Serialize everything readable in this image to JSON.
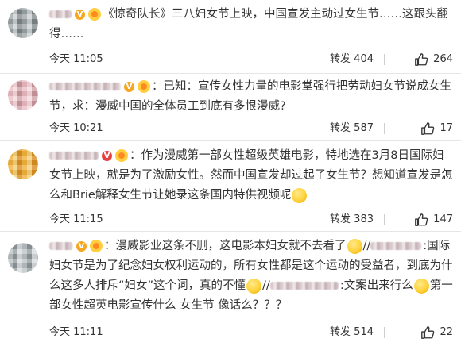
{
  "comments": [
    {
      "text": "《惊奇队长》三八妇女节上映，中国宣发主动过女生节……这跟头翻得……",
      "time": "今天 11:05",
      "repost_label": "转发",
      "repost_count": "404",
      "like_count": "264"
    },
    {
      "text": "：已知：宣传女性力量的电影堂强行把劳动妇女节说成女生节，求：漫威中国的全体员工到底有多恨漫威?",
      "time": "今天 10:21",
      "repost_label": "转发",
      "repost_count": "587",
      "like_count": "17"
    },
    {
      "text": "：作为漫威第一部女性超级英雄电影，特地选在3月8日国际妇女节上映，就是为了激励女性。然而中国宣发却过起了女生节？想知道宣发是怎么和Brie解释女生节让她录这条国内特供视频呢",
      "time": "今天 11:15",
      "repost_label": "转发",
      "repost_count": "383",
      "like_count": "147"
    },
    {
      "text_a": "：漫威影业这条不删，这电影本妇女就不去看了",
      "text_b": "//",
      "text_c": ":国际妇女节是为了纪念妇女权利运动的，所有女性都是这个运动的受益者，到底为什么这多人排斥“妇女”这个词，真的不懂",
      "text_d": "//",
      "text_e": ":文案出来行么",
      "text_f": "第一部女性超英电影宣传什么 女生节 像话么？？？",
      "time": "今天 11:11",
      "repost_label": "转发",
      "repost_count": "514",
      "like_count": "22"
    }
  ],
  "icons": {
    "like": "thumb-up-icon",
    "vip": "v-badge-icon",
    "level": "level-badge-icon",
    "emoji": "emoji-icon"
  },
  "colors": {
    "text": "#333333",
    "divider": "#e6e6e6",
    "vip_gold": "#f5a623",
    "vip_red": "#e64141"
  }
}
